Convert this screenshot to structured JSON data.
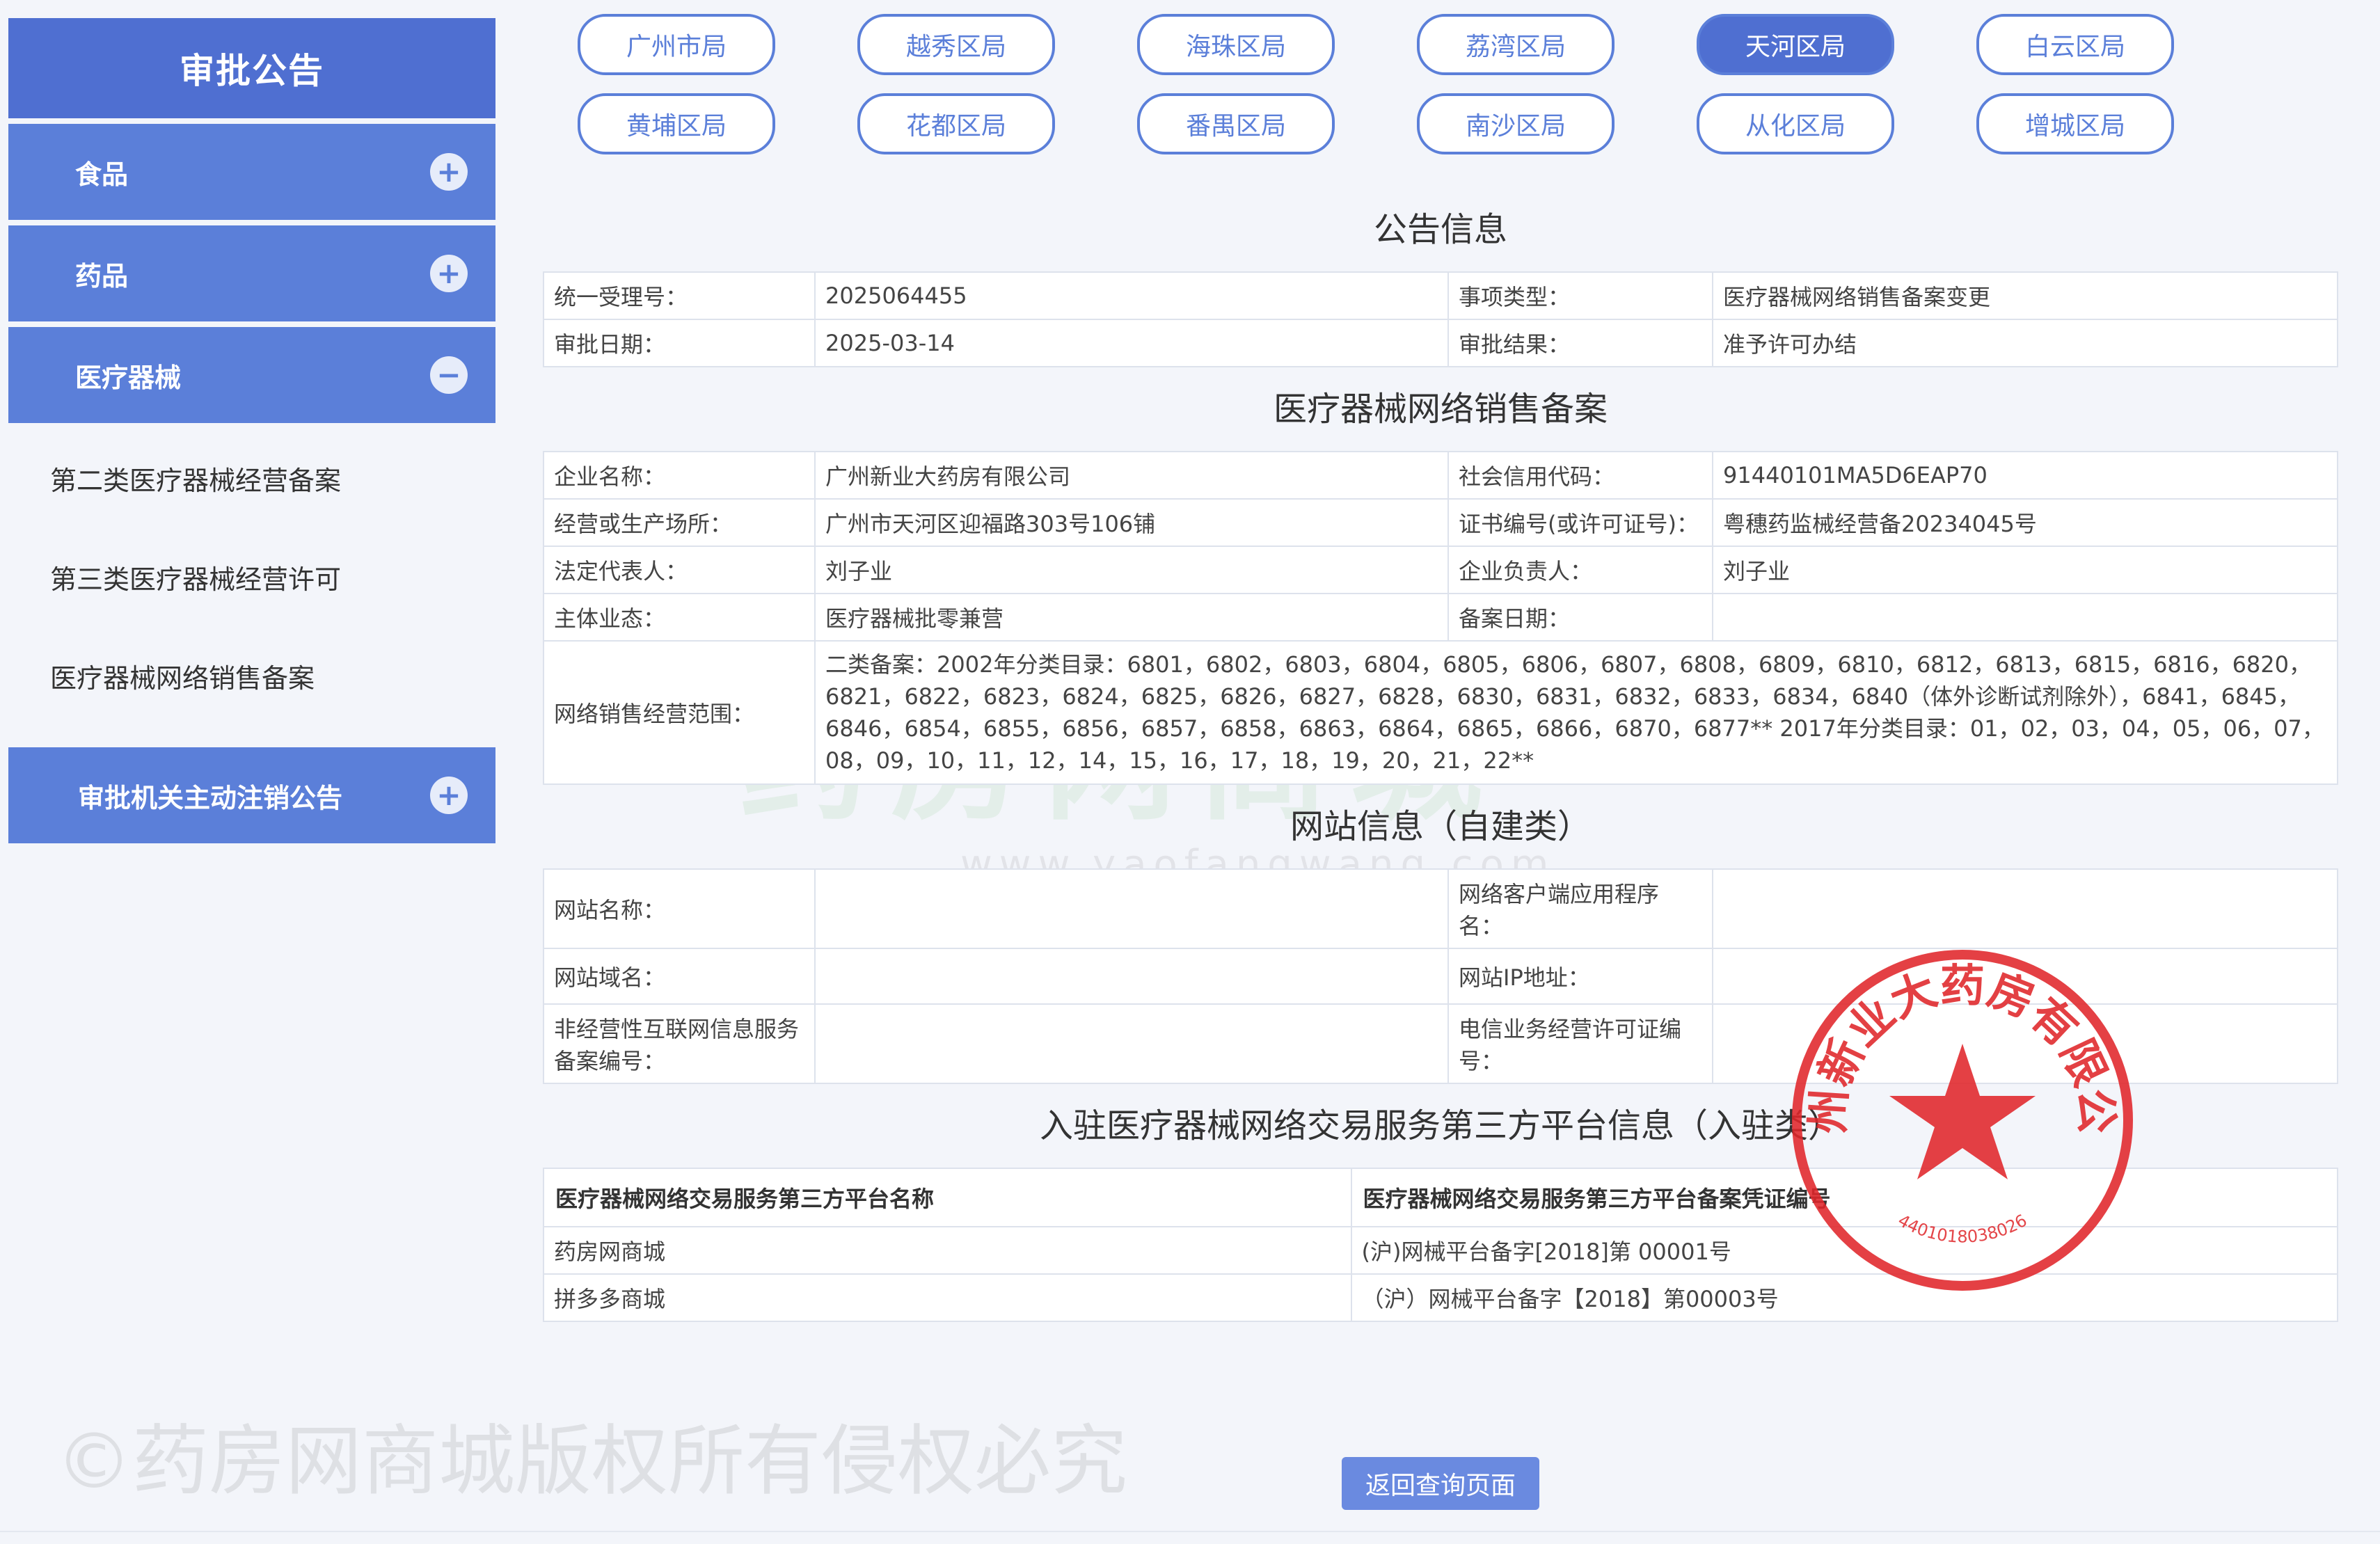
{
  "sidebar": {
    "title": "审批公告",
    "items": [
      {
        "label": "食品",
        "toggle": "+"
      },
      {
        "label": "药品",
        "toggle": "+"
      },
      {
        "label": "医疗器械",
        "toggle": "−"
      }
    ],
    "sub_items": [
      "第二类医疗器械经营备案",
      "第三类医疗器械经营许可",
      "医疗器械网络销售备案"
    ],
    "last_item": {
      "label": "审批机关主动注销公告",
      "toggle": "+"
    }
  },
  "districts": {
    "row1": [
      "广州市局",
      "越秀区局",
      "海珠区局",
      "荔湾区局",
      "天河区局",
      "白云区局"
    ],
    "row2": [
      "黄埔区局",
      "花都区局",
      "番禺区局",
      "南沙区局",
      "从化区局",
      "增城区局"
    ],
    "active": "天河区局"
  },
  "notice": {
    "title": "公告信息",
    "id_label": "统一受理号：",
    "id_value": "2025064455",
    "type_label": "事项类型：",
    "type_value": "医疗器械网络销售备案变更",
    "date_label": "审批日期：",
    "date_value": "2025-03-14",
    "result_label": "审批结果：",
    "result_value": "准予许可办结"
  },
  "filing": {
    "title": "医疗器械网络销售备案",
    "company_label": "企业名称：",
    "company_value": "广州新业大药房有限公司",
    "credit_label": "社会信用代码：",
    "credit_value": "91440101MA5D6EAP70",
    "address_label": "经营或生产场所：",
    "address_value": "广州市天河区迎福路303号106铺",
    "cert_label": "证书编号(或许可证号)：",
    "cert_value": "粤穗药监械经营备20234045号",
    "legal_label": "法定代表人：",
    "legal_value": "刘子业",
    "head_label": "企业负责人：",
    "head_value": "刘子业",
    "business_label": "主体业态：",
    "business_value": "医疗器械批零兼营",
    "filing_date_label": "备案日期：",
    "filing_date_value": "",
    "scope_label": "网络销售经营范围：",
    "scope_value": "二类备案：2002年分类目录：6801，6802，6803，6804，6805，6806，6807，6808，6809，6810，6812，6813，6815，6816，6820，6821，6822，6823，6824，6825，6826，6827，6828，6830，6831，6832，6833，6834，6840（体外诊断试剂除外），6841，6845，6846，6854，6855，6856，6857，6858，6863，6864，6865，6866，6870，6877** 2017年分类目录：01，02，03，04，05，06，07，08，09，10，11，12，14，15，16，17，18，19，20，21，22**"
  },
  "website": {
    "title": "网站信息（自建类）",
    "name_label": "网站名称：",
    "app_label": "网络客户端应用程序名：",
    "domain_label": "网站域名：",
    "ip_label": "网站IP地址：",
    "icp_label": "非经营性互联网信息服务备案编号：",
    "telecom_label": "电信业务经营许可证编号："
  },
  "platform": {
    "title": "入驻医疗器械网络交易服务第三方平台信息（入驻类）",
    "col1": "医疗器械网络交易服务第三方平台名称",
    "col2": "医疗器械网络交易服务第三方平台备案凭证编号",
    "rows": [
      {
        "name": "药房网商城",
        "code": "(沪)网械平台备字[2018]第 00001号"
      },
      {
        "name": "拼多多商城",
        "code": "（沪）网械平台备字【2018】第00003号"
      }
    ]
  },
  "back_button": "返回查询页面",
  "watermarks": {
    "bottom": "©药房网商城版权所有侵权必究",
    "middle": "药房网商城",
    "url": "www.yaofangwang.com"
  },
  "seal": {
    "text": "广州新业大药房有限公司",
    "code": "4401018038026"
  },
  "colors": {
    "primary": "#4f6fd1",
    "button": "#5b7fd9",
    "seal": "#e0262a"
  }
}
